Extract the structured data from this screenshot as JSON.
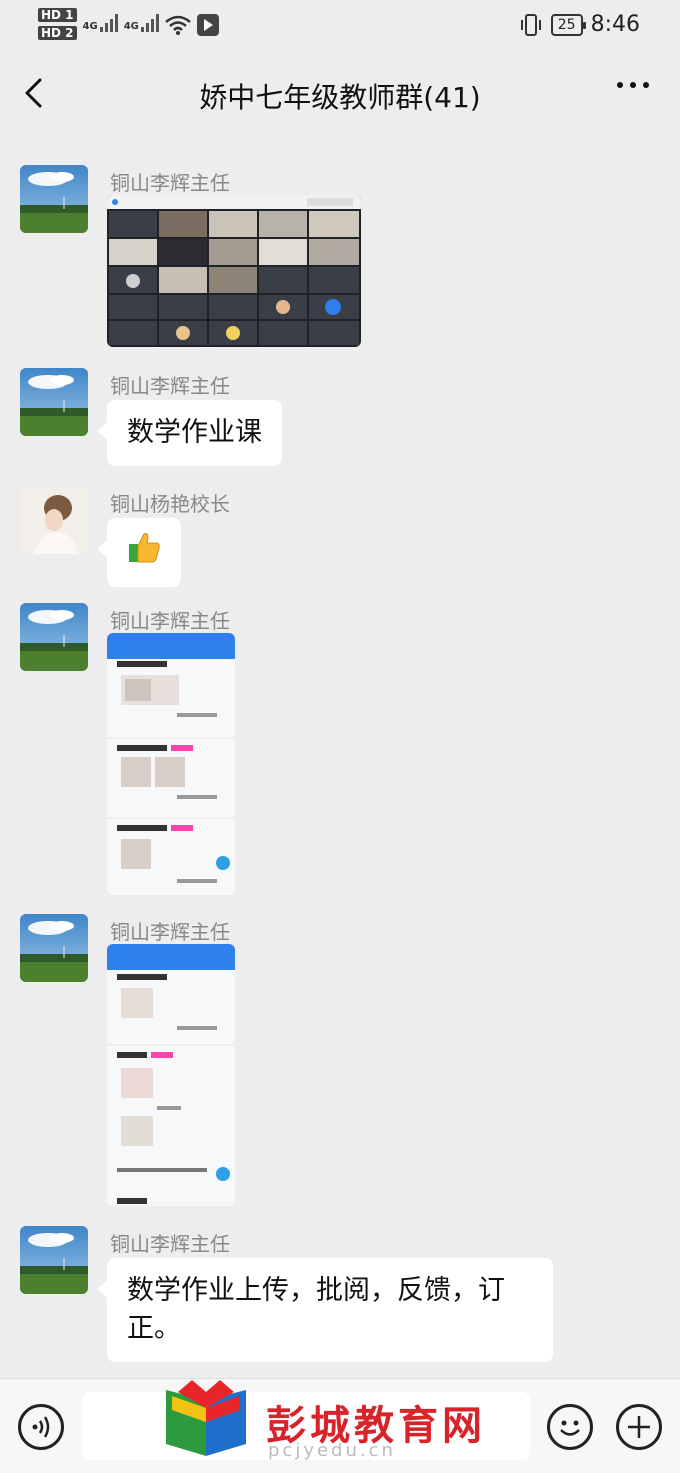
{
  "status_bar": {
    "sim1_label": "HD 1",
    "sim2_label": "HD 2",
    "network1": "4G",
    "network2": "4G",
    "battery": "25",
    "time": "8:46",
    "icons": [
      "signal-icon",
      "wifi-icon",
      "vibrate-icon",
      "battery-icon"
    ]
  },
  "header": {
    "title": "娇中七年级教师群(41)",
    "back_icon": "chevron-left-icon",
    "more_icon": "more-dots-icon"
  },
  "messages": [
    {
      "sender": "铜山李辉主任",
      "type": "image",
      "content": "video-conference-screenshot"
    },
    {
      "sender": "铜山李辉主任",
      "type": "text",
      "content": "数学作业课"
    },
    {
      "sender": "铜山杨艳校长",
      "type": "emoji",
      "content": "thumbs-up"
    },
    {
      "sender": "铜山李辉主任",
      "type": "image",
      "content": "homework-app-screenshot-1"
    },
    {
      "sender": "铜山李辉主任",
      "type": "image",
      "content": "homework-app-screenshot-2"
    },
    {
      "sender": "铜山李辉主任",
      "type": "text",
      "content": "数学作业上传，批阅，反馈，订正。"
    }
  ],
  "message_text": {
    "m2": "数学作业课",
    "m6_line1": "数学作业上传，批阅，反馈，订",
    "m6_line2": "正。"
  },
  "input_bar": {
    "icons": [
      "voice-icon",
      "emoji-icon",
      "plus-icon"
    ]
  },
  "watermark": {
    "text": "彭城教育网",
    "url": "pcjyedu.cn"
  },
  "colors": {
    "background": "#ededed",
    "bubble": "#ffffff",
    "sender_name": "#888888",
    "watermark_red": "#d8232a",
    "app_blue": "#2f80ed"
  }
}
